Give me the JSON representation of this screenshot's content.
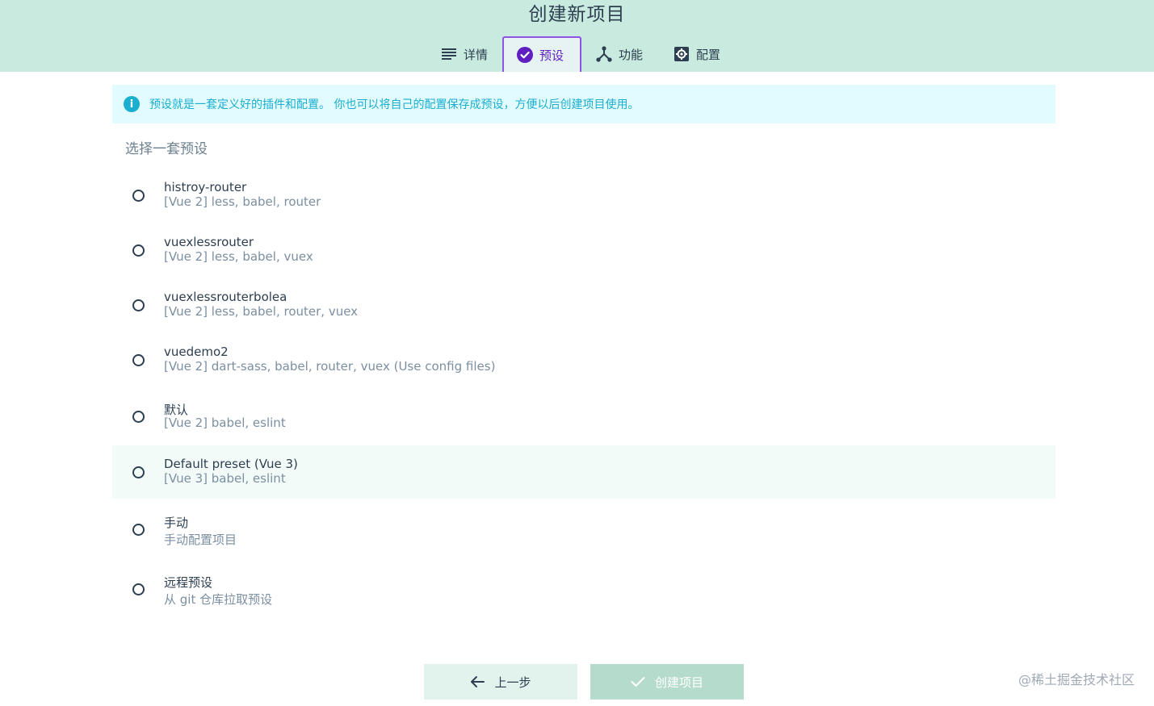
{
  "page": {
    "title": "创建新项目"
  },
  "tabs": [
    {
      "label": "详情",
      "icon": "list-icon"
    },
    {
      "label": "预设",
      "icon": "check-circle-icon",
      "active": true
    },
    {
      "label": "功能",
      "icon": "fork-icon"
    },
    {
      "label": "配置",
      "icon": "settings-icon"
    }
  ],
  "info": {
    "text": "预设就是一套定义好的插件和配置。 你也可以将自己的配置保存成预设，方便以后创建项目使用。"
  },
  "section": {
    "title": "选择一套预设"
  },
  "presets": [
    {
      "name": "histroy-router",
      "desc": "[Vue 2] less, babel, router"
    },
    {
      "name": "vuexlessrouter",
      "desc": "[Vue 2] less, babel, vuex"
    },
    {
      "name": "vuexlessrouterbolea",
      "desc": "[Vue 2] less, babel, router, vuex"
    },
    {
      "name": "vuedemo2",
      "desc": "[Vue 2] dart-sass, babel, router, vuex (Use config files)"
    },
    {
      "name": "默认",
      "desc": "[Vue 2] babel, eslint"
    },
    {
      "name": "Default preset (Vue 3)",
      "desc": "[Vue 3] babel, eslint"
    },
    {
      "name": "手动",
      "desc": "手动配置项目"
    },
    {
      "name": "远程预设",
      "desc": "从 git 仓库拉取预设"
    }
  ],
  "buttons": {
    "prev": "上一步",
    "create": "创建项目"
  },
  "watermark": "@稀土掘金技术社区",
  "colors": {
    "header_bg": "#c9eade",
    "accent": "#8e53e0",
    "info": "#1aaecf"
  }
}
